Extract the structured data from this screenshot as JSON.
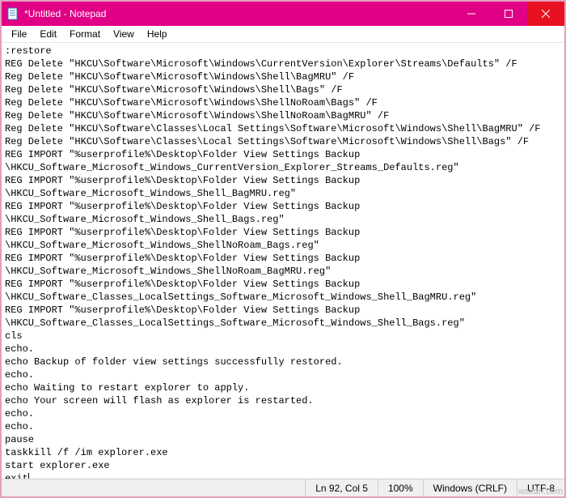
{
  "window": {
    "title": "*Untitled - Notepad"
  },
  "menu": {
    "items": [
      {
        "label": "File"
      },
      {
        "label": "Edit"
      },
      {
        "label": "Format"
      },
      {
        "label": "View"
      },
      {
        "label": "Help"
      }
    ]
  },
  "editor": {
    "lines": [
      ":restore",
      "REG Delete \"HKCU\\Software\\Microsoft\\Windows\\CurrentVersion\\Explorer\\Streams\\Defaults\" /F",
      "Reg Delete \"HKCU\\Software\\Microsoft\\Windows\\Shell\\BagMRU\" /F",
      "Reg Delete \"HKCU\\Software\\Microsoft\\Windows\\Shell\\Bags\" /F",
      "Reg Delete \"HKCU\\Software\\Microsoft\\Windows\\ShellNoRoam\\Bags\" /F",
      "Reg Delete \"HKCU\\Software\\Microsoft\\Windows\\ShellNoRoam\\BagMRU\" /F",
      "Reg Delete \"HKCU\\Software\\Classes\\Local Settings\\Software\\Microsoft\\Windows\\Shell\\BagMRU\" /F",
      "Reg Delete \"HKCU\\Software\\Classes\\Local Settings\\Software\\Microsoft\\Windows\\Shell\\Bags\" /F",
      "",
      "REG IMPORT \"%userprofile%\\Desktop\\Folder View Settings Backup",
      "\\HKCU_Software_Microsoft_Windows_CurrentVersion_Explorer_Streams_Defaults.reg\"",
      "REG IMPORT \"%userprofile%\\Desktop\\Folder View Settings Backup",
      "\\HKCU_Software_Microsoft_Windows_Shell_BagMRU.reg\"",
      "REG IMPORT \"%userprofile%\\Desktop\\Folder View Settings Backup",
      "\\HKCU_Software_Microsoft_Windows_Shell_Bags.reg\"",
      "REG IMPORT \"%userprofile%\\Desktop\\Folder View Settings Backup",
      "\\HKCU_Software_Microsoft_Windows_ShellNoRoam_Bags.reg\"",
      "REG IMPORT \"%userprofile%\\Desktop\\Folder View Settings Backup",
      "\\HKCU_Software_Microsoft_Windows_ShellNoRoam_BagMRU.reg\"",
      "REG IMPORT \"%userprofile%\\Desktop\\Folder View Settings Backup",
      "\\HKCU_Software_Classes_LocalSettings_Software_Microsoft_Windows_Shell_BagMRU.reg\"",
      "REG IMPORT \"%userprofile%\\Desktop\\Folder View Settings Backup",
      "\\HKCU_Software_Classes_LocalSettings_Software_Microsoft_Windows_Shell_Bags.reg\"",
      "cls",
      "echo.",
      "echo Backup of folder view settings successfully restored.",
      "echo.",
      "echo Waiting to restart explorer to apply.",
      "echo Your screen will flash as explorer is restarted.",
      "echo.",
      "echo.",
      "pause",
      "taskkill /f /im explorer.exe",
      "start explorer.exe",
      "exit"
    ]
  },
  "status": {
    "position": "Ln 92, Col 5",
    "zoom": "100%",
    "lineending": "Windows (CRLF)",
    "encoding": "UTF-8"
  },
  "watermark": "wsxdn.com"
}
